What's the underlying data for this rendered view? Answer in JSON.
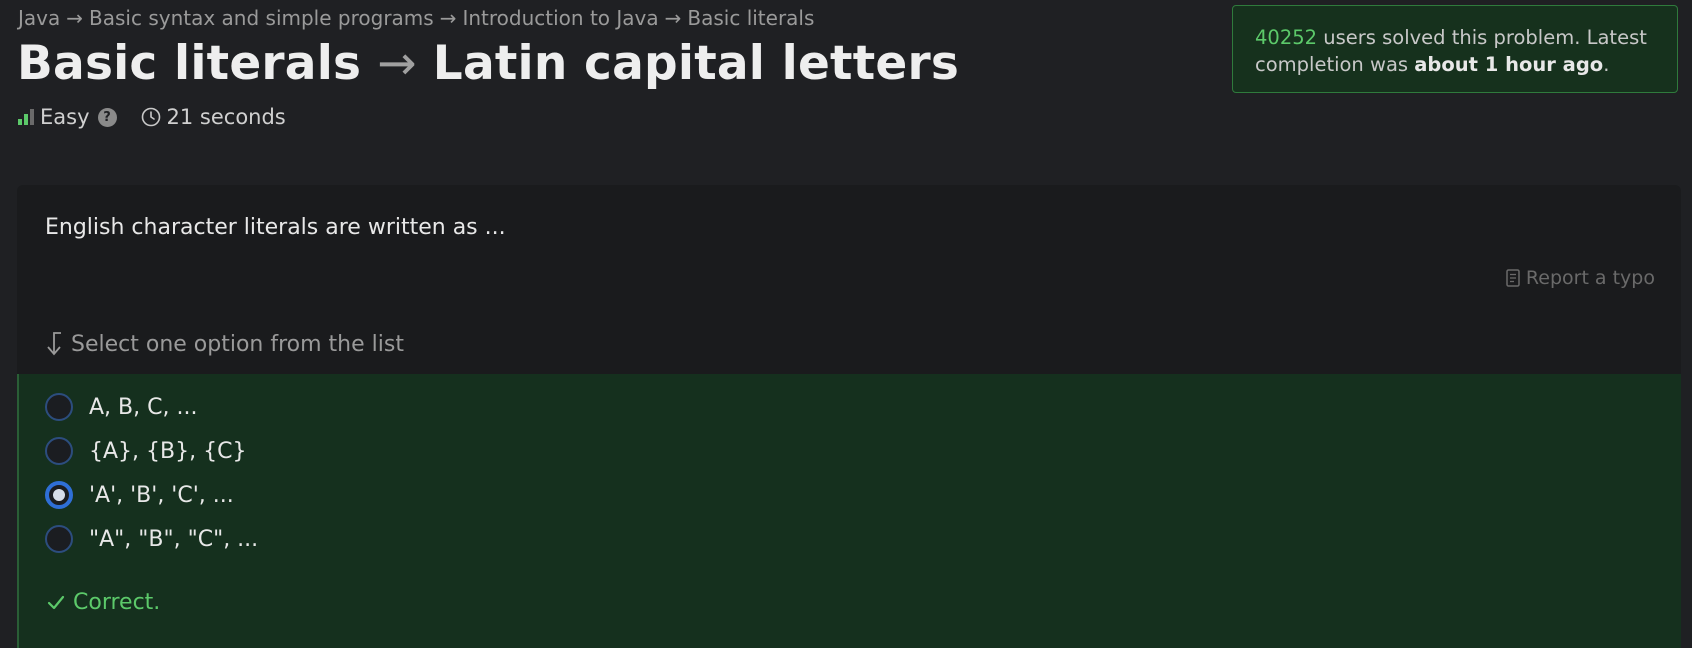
{
  "breadcrumb": {
    "items": [
      "Java",
      "Basic syntax and simple programs",
      "Introduction to Java",
      "Basic literals"
    ],
    "separator": "→"
  },
  "title": {
    "topic": "Basic literals",
    "arrow": "→",
    "problem": "Latin capital letters"
  },
  "meta": {
    "difficulty": "Easy",
    "difficulty_level": 2,
    "difficulty_max": 3,
    "help_glyph": "?",
    "time": "21 seconds"
  },
  "solved": {
    "count": "40252",
    "text_middle": " users solved this problem. Latest completion was ",
    "last": "about 1 hour ago",
    "end": "."
  },
  "question": {
    "text": "English character literals are written as ...",
    "report_label": "Report a typo",
    "select_hint": "Select one option from the list"
  },
  "options": [
    {
      "label": "A, B, C, ...",
      "checked": false
    },
    {
      "label": "{A}, {B}, {C}",
      "checked": false
    },
    {
      "label": "'A', 'B', 'C', ...",
      "checked": true
    },
    {
      "label": "\"A\", \"B\", \"C\", ...",
      "checked": false
    }
  ],
  "feedback": {
    "text": "Correct."
  },
  "colors": {
    "accent_green": "#5cc96a",
    "radio_blue": "#2f6fd6",
    "success_bg": "#15301e",
    "page_bg": "#1f2023"
  }
}
